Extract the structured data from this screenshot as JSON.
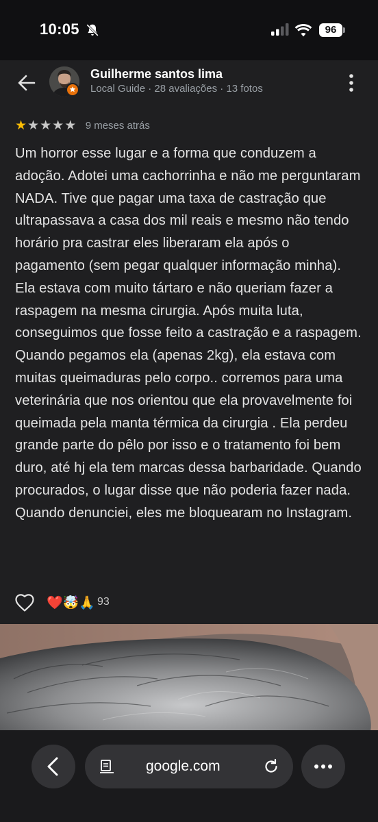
{
  "status_bar": {
    "time": "10:05",
    "battery": "96"
  },
  "reviewer": {
    "name": "Guilherme santos lima",
    "subtitle": "Local Guide · 28 avaliações · 13 fotos"
  },
  "review": {
    "stars_filled": 1,
    "stars_total": 5,
    "time_ago": "9 meses atrás",
    "text": "Um horror esse lugar e a forma que conduzem a adoção. Adotei uma cachorrinha e não me perguntaram NADA. Tive que pagar uma taxa de castração que ultrapassava a casa dos mil reais e mesmo não tendo horário pra castrar eles liberaram ela após o pagamento (sem pegar qualquer informação minha). Ela estava com muito tártaro e não queriam fazer a raspagem na mesma cirurgia. Após muita luta, conseguimos que fosse feito a castração e a raspagem. Quando pegamos ela (apenas 2kg), ela estava com muitas queimaduras pelo corpo.. corremos para uma veterinária que nos orientou que ela provavelmente foi queimada pela manta térmica da cirurgia . Ela perdeu grande parte do pêlo por isso e o tratamento foi bem duro, até hj ela tem marcas dessa barbaridade. Quando procurados, o lugar disse que não poderia fazer nada. Quando denunciei, eles me bloquearam no Instagram."
  },
  "reactions": {
    "emojis": "❤️🤯🙏",
    "count": "93"
  },
  "browser": {
    "url": "google.com"
  },
  "icons": {
    "bell": "bell-slash-icon",
    "signal": "cellular-signal-icon",
    "wifi": "wifi-icon",
    "battery": "battery-icon",
    "back": "arrow-left-icon",
    "more": "more-vertical-icon",
    "heart": "heart-outline-icon",
    "reader": "reader-mode-icon",
    "reload": "reload-icon"
  },
  "colors": {
    "background": "#1f1f21",
    "star": "#fbbc04",
    "badge": "#e8710a"
  }
}
